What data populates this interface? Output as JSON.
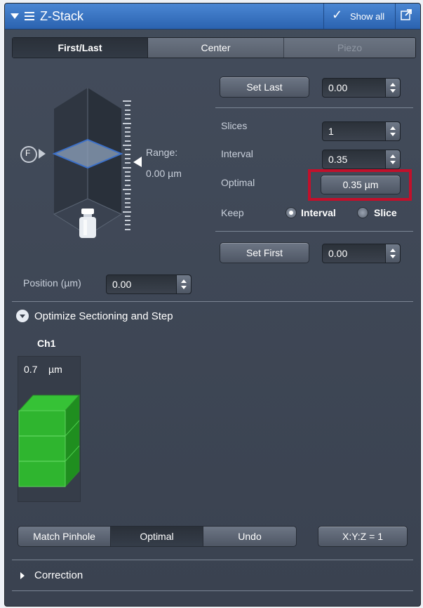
{
  "window": {
    "title": "Z-Stack",
    "show_all_label": "Show all",
    "check_glyph": "✓"
  },
  "tabs": [
    {
      "label": "First/Last",
      "active": true
    },
    {
      "label": "Center",
      "active": false
    },
    {
      "label": "Piezo",
      "active": false,
      "disabled": true
    }
  ],
  "stack": {
    "focus_label": "F",
    "range_label": "Range:",
    "range_value": "0.00 µm"
  },
  "controls": {
    "set_last_label": "Set Last",
    "set_last_value": "0.00",
    "slices_label": "Slices",
    "slices_value": "1",
    "interval_label": "Interval",
    "interval_value": "0.35",
    "optimal_label": "Optimal",
    "optimal_button": "0.35 µm",
    "keep_label": "Keep",
    "keep_interval": "Interval",
    "keep_slice": "Slice",
    "keep_selected": "Interval",
    "set_first_label": "Set First",
    "set_first_value": "0.00"
  },
  "position": {
    "label": "Position (µm)",
    "value": "0.00"
  },
  "sectioning": {
    "title": "Optimize Sectioning and Step",
    "channel": "Ch1",
    "section_value": "0.7",
    "section_unit": "µm",
    "match_pinhole": "Match Pinhole",
    "optimal": "Optimal",
    "undo": "Undo",
    "xyz": "X:Y:Z = 1"
  },
  "correction": {
    "title": "Correction"
  },
  "colors": {
    "titlebar": "#2f6ab8",
    "panel": "#3e4654",
    "highlight": "#c2102b",
    "block": "#27a527"
  }
}
